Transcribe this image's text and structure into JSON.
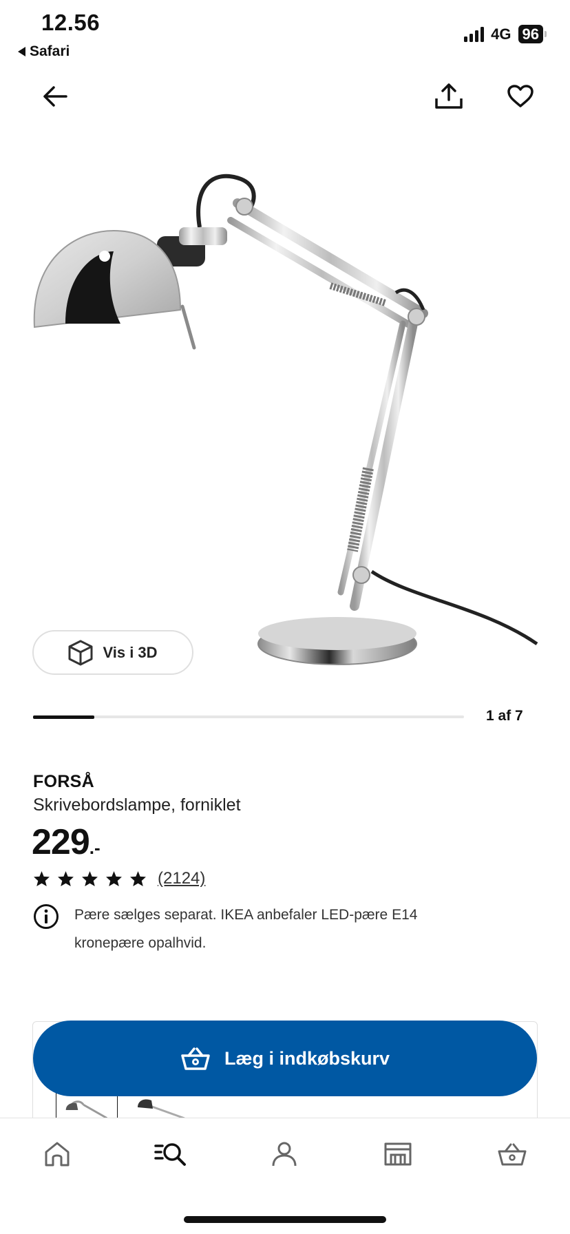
{
  "status_bar": {
    "time": "12.56",
    "back_app": "Safari",
    "network": "4G",
    "battery": "96"
  },
  "header": {
    "back_icon": "arrow-left-icon",
    "share_icon": "share-icon",
    "favorite_icon": "heart-icon"
  },
  "gallery": {
    "view_3d_label": "Vis i 3D",
    "counter": "1 af 7",
    "current": 1,
    "total": 7
  },
  "product": {
    "brand": "FORSÅ",
    "description": "Skrivebordslampe, forniklet",
    "price": "229",
    "price_suffix": ".-",
    "rating": 5,
    "review_count": "(2124)",
    "info_text": "Pære sælges separat. IKEA anbefaler LED-pære E14 kronepære opalhvid."
  },
  "cta": {
    "add_to_cart_label": "Læg i indkøbskurv",
    "color": "#0058a3"
  },
  "tabbar": {
    "items": [
      {
        "icon": "home-icon"
      },
      {
        "icon": "search-list-icon",
        "active": true
      },
      {
        "icon": "profile-icon"
      },
      {
        "icon": "store-icon"
      },
      {
        "icon": "basket-icon"
      }
    ]
  }
}
